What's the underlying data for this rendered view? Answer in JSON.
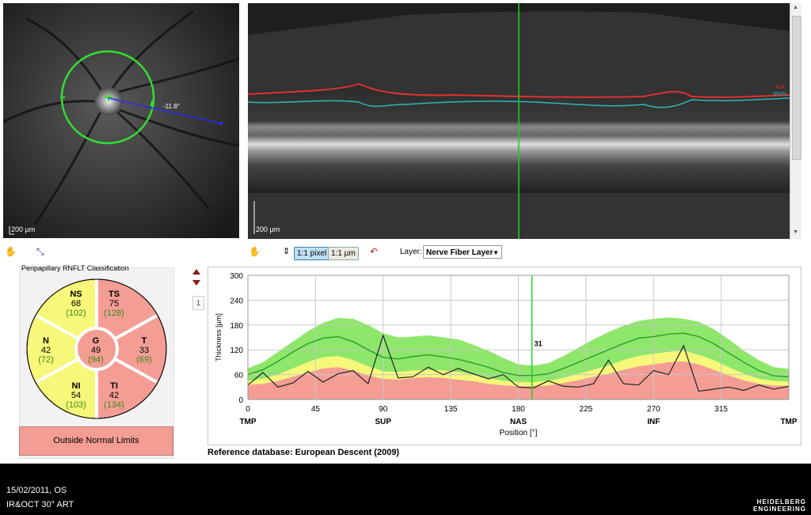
{
  "fundus": {
    "scale_label": "200 µm",
    "angle_label": "-11.8°"
  },
  "bscan": {
    "scale_label": "200 µm",
    "layer_labels": [
      "ILM",
      "RNFL"
    ]
  },
  "toolbar": {
    "pixel_label": "1:1 pixel",
    "um_label": "1:1 µm",
    "layer_label": "Layer:",
    "layer_value": "Nerve Fiber Layer"
  },
  "classification": {
    "title": "Peripapillary RNFLT Classification",
    "sectors": [
      {
        "name": "NS",
        "value": "68",
        "ref": "(102)"
      },
      {
        "name": "TS",
        "value": "75",
        "ref": "(128)"
      },
      {
        "name": "N",
        "value": "42",
        "ref": "(72)"
      },
      {
        "name": "G",
        "value": "49",
        "ref": "(94)"
      },
      {
        "name": "T",
        "value": "33",
        "ref": "(69)"
      },
      {
        "name": "NI",
        "value": "54",
        "ref": "(103)"
      },
      {
        "name": "TI",
        "value": "42",
        "ref": "(134)"
      }
    ],
    "status": "Outside Normal Limits"
  },
  "pager": {
    "page": "1"
  },
  "chart_data": {
    "type": "line",
    "ylabel": "Thickness [µm]",
    "xlabel": "Position [°]",
    "ylim": [
      0,
      300
    ],
    "xlim": [
      0,
      360
    ],
    "y_ticks": [
      0,
      60,
      120,
      180,
      240,
      300
    ],
    "x_ticks": [
      0,
      45,
      90,
      135,
      180,
      225,
      270,
      315
    ],
    "region_labels": [
      {
        "label": "TMP",
        "x": 0
      },
      {
        "label": "SUP",
        "x": 90
      },
      {
        "label": "NAS",
        "x": 180
      },
      {
        "label": "INF",
        "x": 270
      },
      {
        "label": "TMP",
        "x": 360
      }
    ],
    "cursor": {
      "x": 189,
      "label": "31"
    },
    "x": [
      0,
      10,
      20,
      30,
      40,
      50,
      60,
      70,
      80,
      90,
      100,
      110,
      120,
      130,
      140,
      150,
      160,
      170,
      180,
      190,
      200,
      210,
      220,
      230,
      240,
      250,
      260,
      270,
      280,
      290,
      300,
      310,
      320,
      330,
      340,
      350,
      360
    ],
    "measured": [
      35,
      65,
      30,
      40,
      68,
      42,
      62,
      70,
      38,
      155,
      52,
      55,
      78,
      60,
      75,
      62,
      50,
      60,
      30,
      28,
      45,
      32,
      30,
      38,
      95,
      38,
      35,
      70,
      60,
      130,
      20,
      25,
      30,
      22,
      35,
      25,
      32
    ],
    "normal_mean": [
      60,
      72,
      92,
      115,
      135,
      148,
      152,
      140,
      120,
      102,
      98,
      104,
      108,
      103,
      97,
      88,
      78,
      65,
      58,
      58,
      62,
      75,
      90,
      105,
      120,
      135,
      148,
      152,
      158,
      160,
      152,
      135,
      112,
      90,
      70,
      57,
      55
    ],
    "upper_95": [
      75,
      90,
      115,
      140,
      165,
      185,
      197,
      195,
      180,
      160,
      150,
      152,
      155,
      150,
      145,
      132,
      118,
      100,
      85,
      82,
      88,
      105,
      125,
      145,
      163,
      178,
      190,
      195,
      198,
      195,
      188,
      170,
      145,
      118,
      95,
      78,
      74
    ],
    "lower_5": [
      45,
      50,
      60,
      75,
      90,
      102,
      105,
      95,
      80,
      68,
      66,
      70,
      72,
      70,
      66,
      60,
      52,
      45,
      42,
      42,
      45,
      52,
      62,
      72,
      82,
      95,
      105,
      110,
      115,
      118,
      108,
      95,
      78,
      62,
      50,
      45,
      43
    ],
    "lower_1": [
      35,
      38,
      45,
      55,
      65,
      75,
      78,
      70,
      58,
      50,
      48,
      52,
      54,
      52,
      48,
      44,
      38,
      34,
      32,
      32,
      34,
      40,
      47,
      55,
      62,
      72,
      80,
      85,
      90,
      92,
      85,
      72,
      58,
      46,
      38,
      34,
      33
    ]
  },
  "reference_db": "Reference database: European Descent (2009)",
  "footer": {
    "date": "15/02/2011, OS",
    "mode": "IR&OCT 30° ART",
    "brand_line1": "HEIDELBERG",
    "brand_line2": "ENGINEERING"
  },
  "colors": {
    "green_band": "#8ee66a",
    "yellow_band": "#f7f77a",
    "red_band": "#f49d94",
    "mean_line": "#2aa52a",
    "measured_line": "#222222",
    "cursor": "#22cc22"
  }
}
